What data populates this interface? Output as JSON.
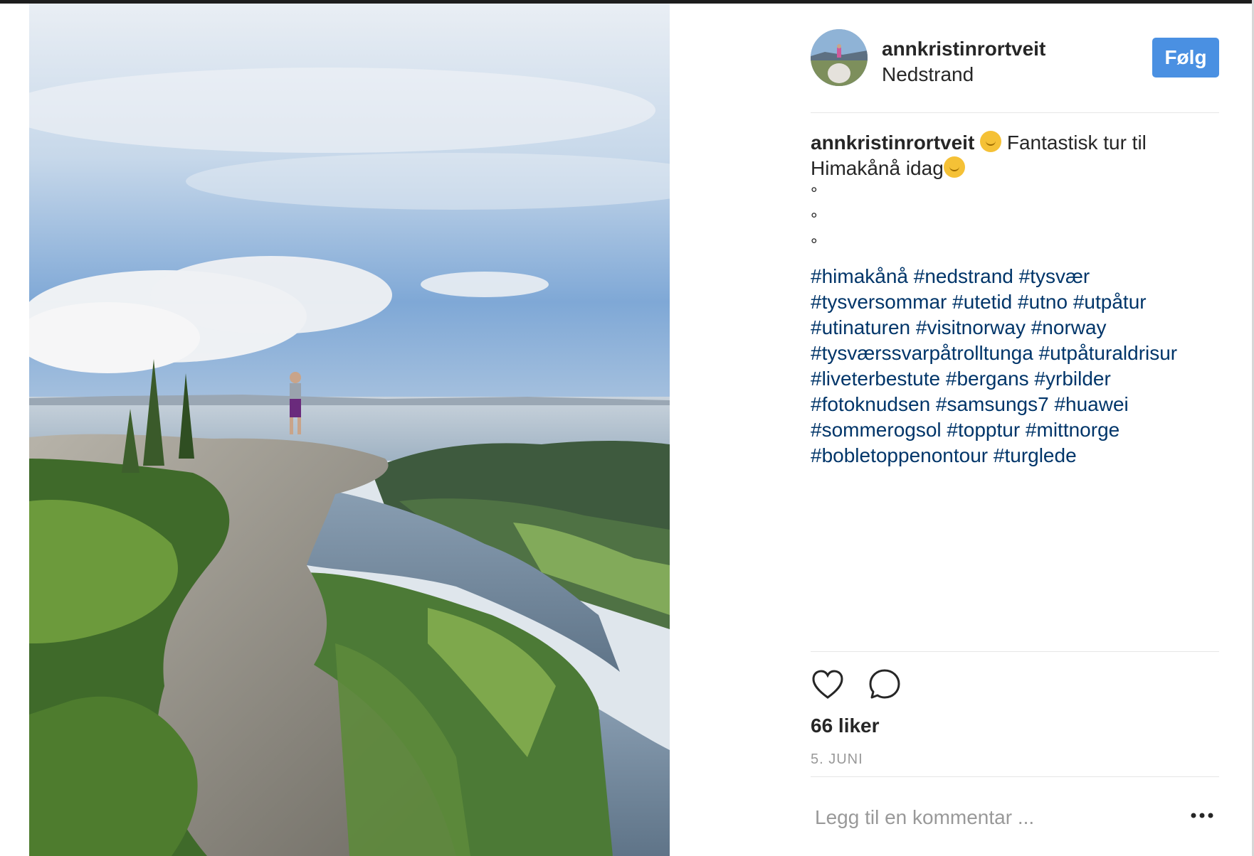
{
  "post": {
    "username": "annkristinrortveit",
    "location": "Nedstrand",
    "follow_label": "Følg",
    "caption": {
      "username": "annkristinrortveit",
      "text_part1": "Fantastisk tur til",
      "text_part2": "Himakånå idag",
      "dots": [
        "°",
        "°",
        "°"
      ],
      "hashtag_lines": [
        "#himakånå #nedstrand #tysvær",
        "#tysversommar #utetid #utno #utpåtur",
        "#utinaturen #visitnorway #norway",
        "#tysværssvarpåtrolltunga #utpåturaldrisur",
        "#liveterbestute #bergans #yrbilder",
        "#fotoknudsen #samsungs7 #huawei",
        "#sommerogsol #topptur #mittnorge",
        "#bobletoppenontour #turglede"
      ],
      "emoji": "sun-with-face"
    },
    "likes": "66 liker",
    "date": "5. JUNI",
    "comment_placeholder": "Legg til en kommentar ...",
    "icons": {
      "like": "heart-icon",
      "comment": "comment-bubble-icon",
      "more": "more-options-icon"
    },
    "colors": {
      "follow_button": "#4a90e2",
      "hashtag": "#003569",
      "text": "#262626",
      "muted": "#999999"
    }
  }
}
